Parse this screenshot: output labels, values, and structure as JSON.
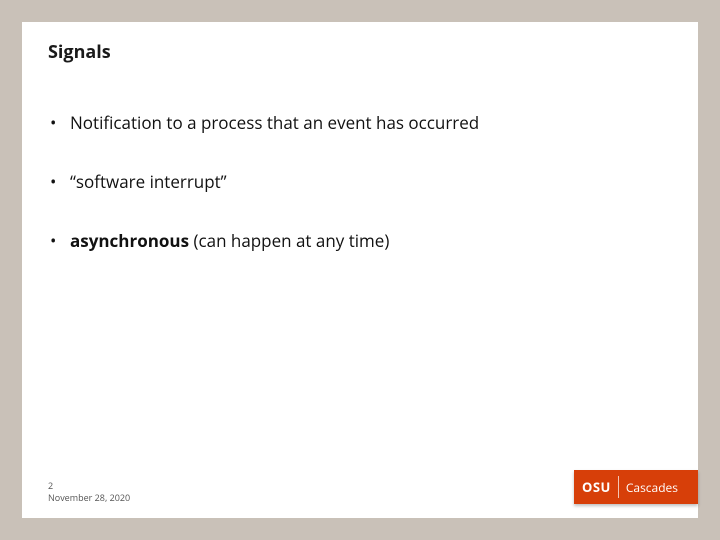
{
  "title": "Signals",
  "bullets": [
    {
      "pre": "",
      "bold": "",
      "post": "Notification to a process that an event has occurred"
    },
    {
      "pre": "",
      "bold": "",
      "post": "“software interrupt”"
    },
    {
      "pre": "",
      "bold": "asynchronous",
      "post": " (can happen at any time)"
    }
  ],
  "footer": {
    "page": "2",
    "date": "November 28, 2020"
  },
  "logo": {
    "short": "OSU",
    "long": "Cascades"
  }
}
